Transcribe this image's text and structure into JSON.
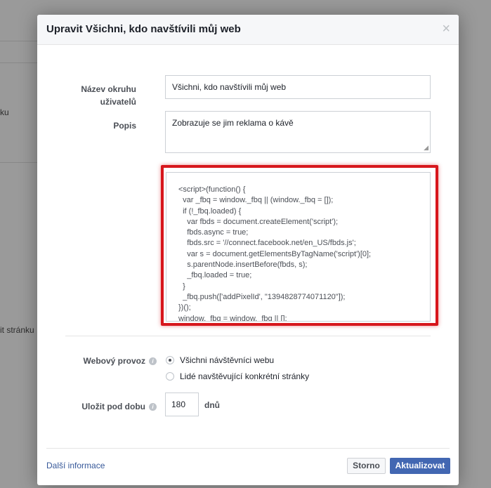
{
  "background": {
    "text_1": "ku",
    "text_2": "it stránku"
  },
  "dialog": {
    "title": "Upravit Všichni, kdo navštívili můj web",
    "close_glyph": "×"
  },
  "form": {
    "name_label": "Název okruhu uživatelů",
    "name_value": "Všichni, kdo navštívili můj web",
    "description_label": "Popis",
    "description_value": "Zobrazuje se jim reklama o kávě",
    "code": "<script>(function() {\n  var _fbq = window._fbq || (window._fbq = []);\n  if (!_fbq.loaded) {\n    var fbds = document.createElement('script');\n    fbds.async = true;\n    fbds.src = '//connect.facebook.net/en_US/fbds.js';\n    var s = document.getElementsByTagName('script')[0];\n    s.parentNode.insertBefore(fbds, s);\n    _fbq.loaded = true;\n  }\n  _fbq.push(['addPixelId', \"1394828774071120\"]);\n})();\nwindow._fbq = window._fbq || [];",
    "traffic_label": "Webový provoz",
    "traffic_options": [
      {
        "label": "Všichni návštěvníci webu",
        "checked": true
      },
      {
        "label": "Lidé navštěvující konkrétní stránky",
        "checked": false
      }
    ],
    "retention_label": "Uložit pod dobu",
    "retention_value": "180",
    "retention_unit": "dnů",
    "help_glyph": "i"
  },
  "footer": {
    "more_info_link": "Další informace",
    "cancel_button": "Storno",
    "update_button": "Aktualizovat"
  },
  "colors": {
    "highlight": "#d7161c",
    "primary_button": "#4267b2",
    "link": "#365899"
  }
}
